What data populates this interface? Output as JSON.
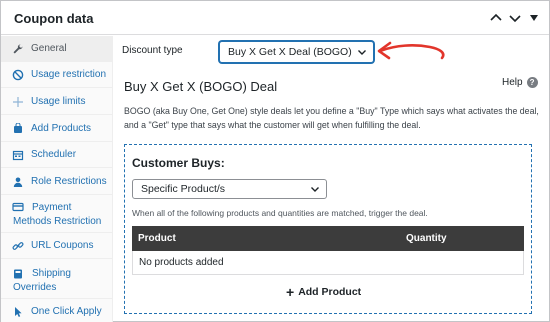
{
  "header": {
    "title": "Coupon data"
  },
  "sidebar": {
    "items": [
      {
        "label": "General",
        "icon": "wrench-icon"
      },
      {
        "label": "Usage restriction",
        "icon": "block-icon"
      },
      {
        "label": "Usage limits",
        "icon": "plus-cross-icon"
      },
      {
        "label": "Add Products",
        "icon": "cart-icon"
      },
      {
        "label": "Scheduler",
        "icon": "calendar-icon"
      },
      {
        "label": "Role Restrictions",
        "icon": "user-icon"
      },
      {
        "label": "Payment Methods Restriction",
        "icon": "card-icon"
      },
      {
        "label": "URL Coupons",
        "icon": "link-icon"
      },
      {
        "label": "Shipping Overrides",
        "icon": "truck-icon"
      },
      {
        "label": "One Click Apply",
        "icon": "pointer-icon"
      }
    ]
  },
  "discount": {
    "label": "Discount type",
    "value": "Buy X Get X Deal (BOGO)"
  },
  "bogo": {
    "title": "Buy X Get X (BOGO) Deal",
    "help": "Help",
    "description": "BOGO (aka Buy One, Get One) style deals let you define a \"Buy\" Type which says what activates the deal, and a \"Get\" type that says what the customer will get when fulfilling the deal."
  },
  "buys": {
    "title": "Customer Buys:",
    "select_value": "Specific Product/s",
    "note": "When all of the following products and quantities are matched, trigger the deal.",
    "columns": [
      "Product",
      "Quantity"
    ],
    "empty_text": "No products added",
    "add_label": "Add Product"
  },
  "colors": {
    "accent": "#2271b1",
    "arrow": "#e2352b",
    "table_header": "#3c3c3c"
  }
}
